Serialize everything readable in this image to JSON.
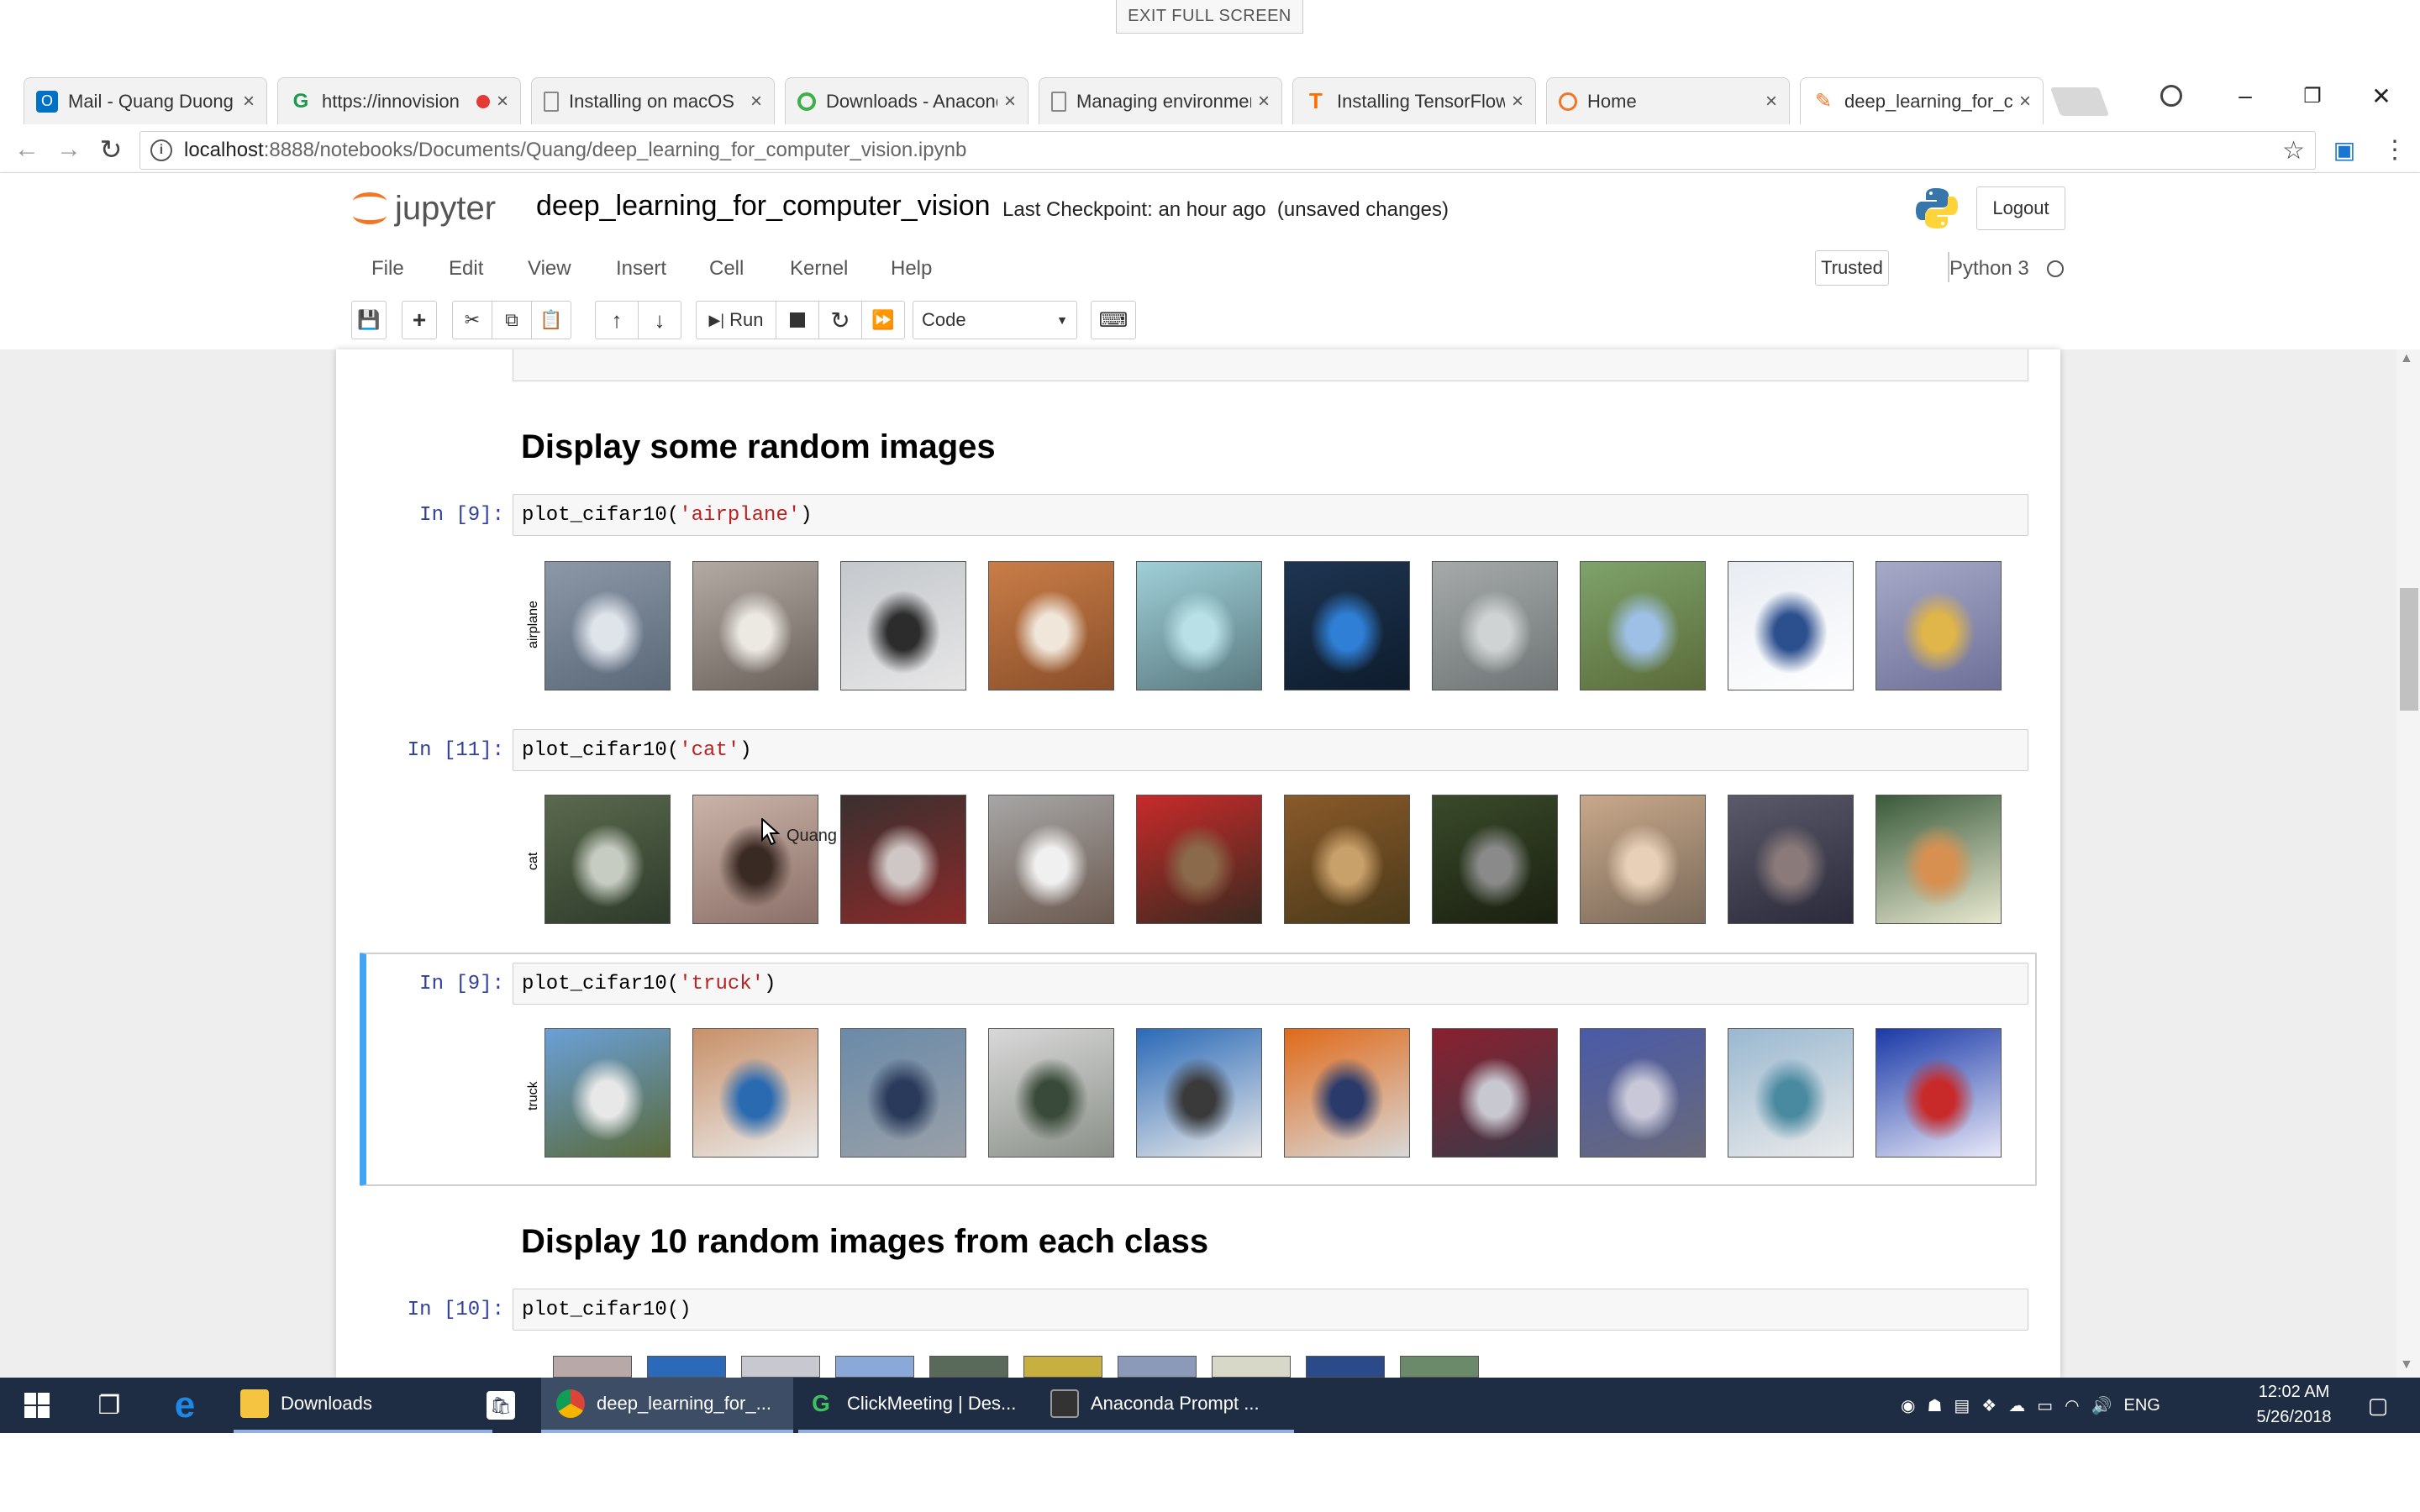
{
  "fullscreen": {
    "exit_label": "EXIT FULL SCREEN"
  },
  "browser": {
    "tabs": [
      {
        "title": "Mail - Quang Duong",
        "icon": "outlook-icon"
      },
      {
        "title": "https://innovision",
        "icon": "clickmeeting-icon"
      },
      {
        "title": "Installing on macOS",
        "icon": "page-icon"
      },
      {
        "title": "Downloads - Anaconda",
        "icon": "anaconda-icon"
      },
      {
        "title": "Managing environments",
        "icon": "page-icon"
      },
      {
        "title": "Installing TensorFlow",
        "icon": "tensorflow-icon"
      },
      {
        "title": "Home",
        "icon": "jupyter-icon"
      },
      {
        "title": "deep_learning_for_computer_vision",
        "icon": "jupyter-icon",
        "active": true
      }
    ],
    "url_host": "localhost",
    "url_path": ":8888/notebooks/Documents/Quang/deep_learning_for_computer_vision.ipynb"
  },
  "jupyter": {
    "logo_text": "jupyter",
    "notebook_name": "deep_learning_for_computer_vision",
    "checkpoint": "Last Checkpoint: an hour ago",
    "unsaved": "(unsaved changes)",
    "logout_label": "Logout",
    "menu": [
      "File",
      "Edit",
      "View",
      "Insert",
      "Cell",
      "Kernel",
      "Help"
    ],
    "trusted_label": "Trusted",
    "kernel_name": "Python 3",
    "toolbar": {
      "run_label": "Run",
      "cell_type": "Code"
    }
  },
  "notebook": {
    "heading1": "Display some random images",
    "heading2": "Display 10 random images from each class",
    "cells": [
      {
        "prompt": "In [9]:",
        "fn": "plot_cifar10(",
        "arg": "'airplane'",
        "close": ")",
        "label": "airplane"
      },
      {
        "prompt": "In [11]:",
        "fn": "plot_cifar10(",
        "arg": "'cat'",
        "close": ")",
        "label": "cat"
      },
      {
        "prompt": "In [9]:",
        "fn": "plot_cifar10(",
        "arg": "'truck'",
        "close": ")",
        "label": "truck"
      },
      {
        "prompt": "In [10]:",
        "fn": "plot_cifar10()",
        "arg": "",
        "close": ""
      }
    ],
    "tooltip": "Quang"
  },
  "taskbar": {
    "items": [
      {
        "label": "Downloads"
      },
      {
        "label": "deep_learning_for_..."
      },
      {
        "label": "ClickMeeting | Des..."
      },
      {
        "label": "Anaconda Prompt ..."
      }
    ],
    "lang": "ENG",
    "time": "12:02 AM",
    "date": "5/26/2018"
  }
}
